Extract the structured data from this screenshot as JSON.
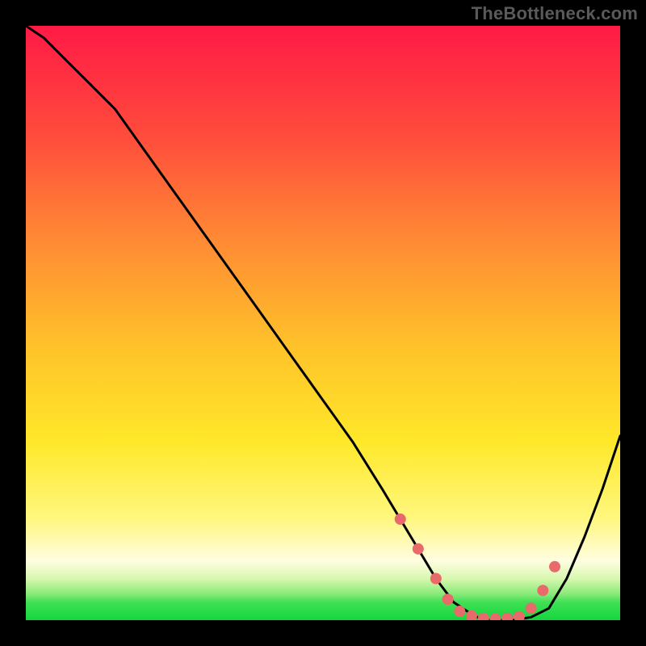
{
  "watermark": "TheBottleneck.com",
  "colors": {
    "bg": "#000000",
    "watermark": "#5a5a5a",
    "curve": "#000000",
    "marker": "#e96a6a",
    "grad_top": "#ff1a46",
    "grad_mid1": "#ff6a3a",
    "grad_mid2": "#ffb030",
    "grad_mid3": "#ffe02a",
    "grad_pale": "#fffccc",
    "grad_green": "#1ee24c"
  },
  "chart_data": {
    "type": "line",
    "title": "",
    "xlabel": "",
    "ylabel": "",
    "xlim": [
      0,
      100
    ],
    "ylim": [
      0,
      100
    ],
    "x": [
      0,
      3,
      7,
      11,
      15,
      20,
      25,
      30,
      35,
      40,
      45,
      50,
      55,
      60,
      63,
      66,
      69,
      72,
      75,
      77,
      79,
      82,
      85,
      88,
      91,
      94,
      97,
      100
    ],
    "values": [
      100,
      98,
      94,
      90,
      86,
      79,
      72,
      65,
      58,
      51,
      44,
      37,
      30,
      22,
      17,
      12,
      7,
      3,
      1,
      0,
      0,
      0,
      0.5,
      2,
      7,
      14,
      22,
      31
    ],
    "marker_points": [
      {
        "x": 63,
        "y": 17
      },
      {
        "x": 66,
        "y": 12
      },
      {
        "x": 69,
        "y": 7
      },
      {
        "x": 71,
        "y": 3.5
      },
      {
        "x": 73,
        "y": 1.5
      },
      {
        "x": 75,
        "y": 0.7
      },
      {
        "x": 77,
        "y": 0.3
      },
      {
        "x": 79,
        "y": 0.2
      },
      {
        "x": 81,
        "y": 0.3
      },
      {
        "x": 83,
        "y": 0.6
      },
      {
        "x": 85,
        "y": 2
      },
      {
        "x": 87,
        "y": 5
      },
      {
        "x": 89,
        "y": 9
      }
    ]
  }
}
